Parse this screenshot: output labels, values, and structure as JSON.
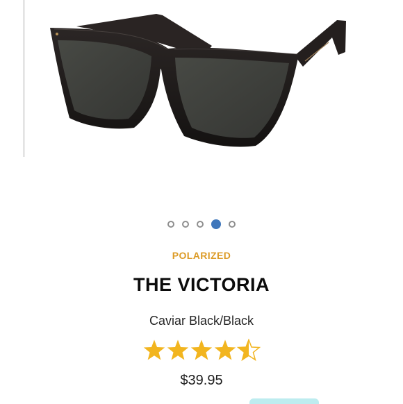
{
  "product": {
    "tag": "POLARIZED",
    "name": "THE VICTORIA",
    "color": "Caviar Black/Black",
    "price": "$39.95",
    "rating": 4.5,
    "rating_max": 5
  },
  "carousel": {
    "total": 5,
    "active_index": 3
  },
  "colors": {
    "tag": "#dc9b27",
    "star": "#f2b51f",
    "active_dot": "#3f77bb",
    "frame": "#1a1716",
    "lens": "#3f403d"
  },
  "icons": {
    "rating": "star-icon"
  }
}
